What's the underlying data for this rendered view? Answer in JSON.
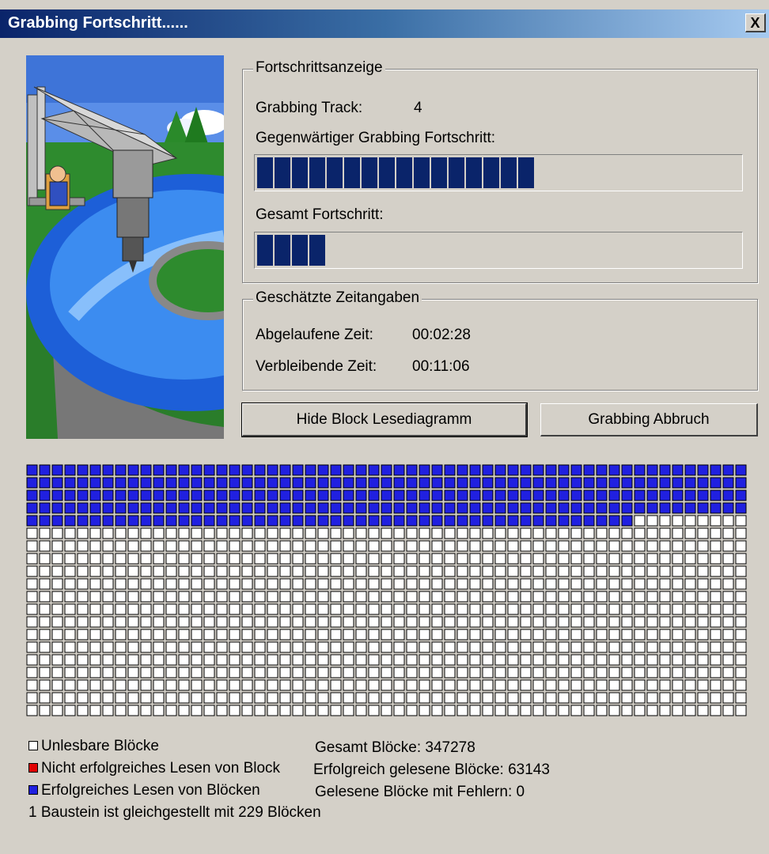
{
  "window": {
    "title": "Grabbing Fortschritt......",
    "close_glyph": "X"
  },
  "progress": {
    "group_label": "Fortschrittsanzeige",
    "track_label": "Grabbing Track:",
    "track_value": "4",
    "current_label": "Gegenwärtiger Grabbing Fortschritt:",
    "current_fraction": 0.59,
    "total_label": "Gesamt Fortschritt:",
    "total_fraction": 0.18
  },
  "times": {
    "group_label": "Geschätzte Zeitangaben",
    "elapsed_label": "Abgelaufene Zeit:",
    "elapsed_value": "00:02:28",
    "remaining_label": "Verbleibende Zeit:",
    "remaining_value": "00:11:06"
  },
  "buttons": {
    "hide_diagram": "Hide Block Lesediagramm",
    "abort": "Grabbing Abbruch"
  },
  "block_map": {
    "columns": 57,
    "rows": 20,
    "read_blocks": 276,
    "color_read": "#2020e0",
    "color_unread": "#ffffff",
    "color_error": "#e00000"
  },
  "legend": {
    "unreadable": "Unlesbare Blöcke",
    "failed": "Nicht erfolgreiches Lesen von Block",
    "success": "Erfolgreiches Lesen von Blöcken",
    "scale": "1 Baustein ist gleichgestellt mit 229 Blöcken",
    "total": "Gesamt Blöcke: 347278",
    "read_ok": "Erfolgreich gelesene Blöcke: 63143",
    "read_err": "Gelesene Blöcke mit Fehlern: 0"
  },
  "icons": {
    "close": "close-icon",
    "illustration": "cd-drilling-illustration"
  }
}
